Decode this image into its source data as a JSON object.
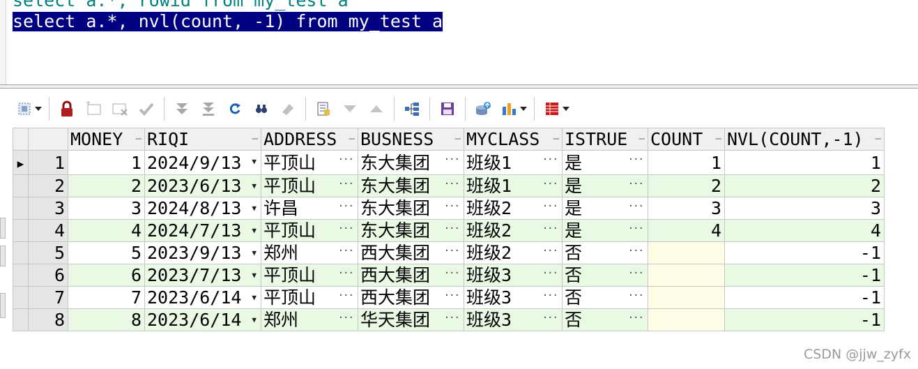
{
  "editor": {
    "line1": "select a.*, rowid from my_test a",
    "line2": "select a.*, nvl(count, -1) from my_test a"
  },
  "toolbar": {
    "icons": [
      "select-mode-icon",
      "lock-icon",
      "insert-record-icon",
      "delete-record-icon",
      "post-changes-icon",
      "next-page-icon",
      "last-page-icon",
      "refresh-icon",
      "find-icon",
      "clear-icon",
      "query-by-example-icon",
      "sort-desc-icon",
      "sort-asc-icon",
      "tree-view-icon",
      "save-icon",
      "export-data-icon",
      "chart-icon",
      "grid-view-icon"
    ]
  },
  "grid": {
    "columns": [
      "MONEY",
      "RIQI",
      "ADDRESS",
      "BUSNESS",
      "MYCLASS",
      "ISTRUE",
      "COUNT",
      "NVL(COUNT,-1)"
    ],
    "rows": [
      {
        "num": "1",
        "money": "1",
        "riqi": "2024/9/13",
        "address": "平顶山",
        "busness": "东大集团",
        "myclass": "班级1",
        "istrue": "是",
        "count": "1",
        "nvl": "1"
      },
      {
        "num": "2",
        "money": "2",
        "riqi": "2023/6/13",
        "address": "平顶山",
        "busness": "东大集团",
        "myclass": "班级1",
        "istrue": "是",
        "count": "2",
        "nvl": "2"
      },
      {
        "num": "3",
        "money": "3",
        "riqi": "2024/8/13",
        "address": "许昌",
        "busness": "东大集团",
        "myclass": "班级2",
        "istrue": "是",
        "count": "3",
        "nvl": "3"
      },
      {
        "num": "4",
        "money": "4",
        "riqi": "2024/7/13",
        "address": "平顶山",
        "busness": "东大集团",
        "myclass": "班级2",
        "istrue": "是",
        "count": "4",
        "nvl": "4"
      },
      {
        "num": "5",
        "money": "5",
        "riqi": "2023/9/13",
        "address": "郑州",
        "busness": "西大集团",
        "myclass": "班级2",
        "istrue": "否",
        "count": "",
        "nvl": "-1"
      },
      {
        "num": "6",
        "money": "6",
        "riqi": "2023/7/13",
        "address": "平顶山",
        "busness": "西大集团",
        "myclass": "班级3",
        "istrue": "否",
        "count": "",
        "nvl": "-1"
      },
      {
        "num": "7",
        "money": "7",
        "riqi": "2023/6/14",
        "address": "平顶山",
        "busness": "西大集团",
        "myclass": "班级3",
        "istrue": "否",
        "count": "",
        "nvl": "-1"
      },
      {
        "num": "8",
        "money": "8",
        "riqi": "2023/6/14",
        "address": "郑州",
        "busness": "华天集团",
        "myclass": "班级3",
        "istrue": "否",
        "count": "",
        "nvl": "-1"
      }
    ]
  },
  "watermark": "CSDN @jjw_zyfx"
}
